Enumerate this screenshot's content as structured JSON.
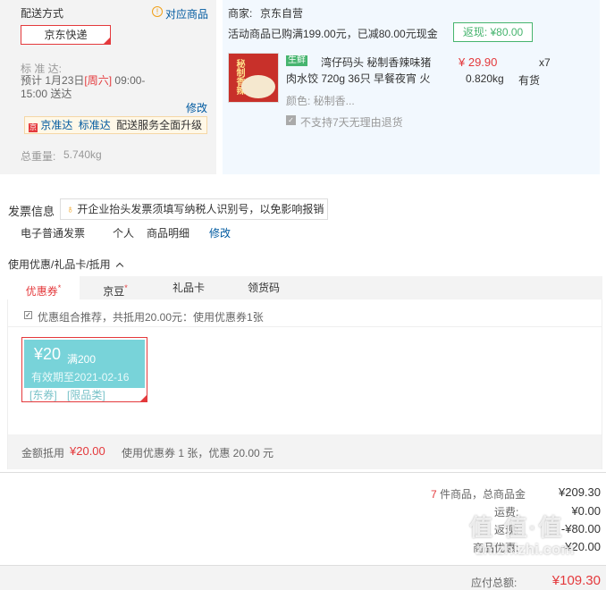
{
  "shipping": {
    "title": "配送方式",
    "match_products": "对应商品",
    "method": "京东快递",
    "std_label": "标 准 达:",
    "estimate_prefix": "预计",
    "date": "1月23日",
    "weekday": "[周六]",
    "time_line1": "09:00-",
    "time_line2": "15:00 送达",
    "modify": "修改",
    "jzd_icon": "京",
    "jzd_name": "京准达",
    "bzd_name": "标准达",
    "upgrade_text": "配送服务全面升级",
    "weight_label": "总重量:",
    "weight_value": "5.740kg"
  },
  "shop": {
    "seller_label": "商家:",
    "seller_name": "京东自营",
    "promo_text": "活动商品已购满199.00元，已减80.00元现金",
    "cashback": "返现: ¥80.00",
    "product": {
      "fresh_tag": "生鲜",
      "title_line1": "湾仔码头 秘制香辣味猪",
      "title_line2": "肉水饺 720g 36只 早餐夜宵 火",
      "price": "¥ 29.90",
      "qty": "x7",
      "weight": "0.820kg",
      "stock": "有货",
      "color": "颜色: 秘制香...",
      "no_return": "不支持7天无理由退货",
      "image_text": "秘制香辣"
    }
  },
  "invoice": {
    "title": "发票信息",
    "notice": "开企业抬头发票须填写纳税人识别号，以免影响报销",
    "type": "电子普通发票",
    "person": "个人",
    "detail": "商品明细",
    "modify": "修改"
  },
  "discount": {
    "title": "使用优惠/礼品卡/抵用",
    "tabs": [
      "优惠券",
      "京豆",
      "礼品卡",
      "领货码"
    ],
    "combo_text": "优惠组合推荐，共抵用20.00元：使用优惠券1张",
    "coupon": {
      "amount": "¥20",
      "condition": "满200",
      "expiry": "有效期至2021-02-16",
      "tag1": "[东券]",
      "tag2": "[限品类]"
    },
    "deduct_label": "金额抵用",
    "deduct_value": "¥20.00",
    "deduct_desc": "使用优惠券 1 张，优惠 20.00 元"
  },
  "summary": {
    "count": "7",
    "count_label": "件商品，总商品金",
    "total": "¥209.30",
    "freight_label": "运费:",
    "freight": "¥0.00",
    "row3_label": "返现:",
    "row3_value": "-¥80.00",
    "row4_label": "商品优惠:",
    "row4_value": "-¥20.00",
    "payable_label": "应付总额:",
    "payable": "¥109.30"
  },
  "watermark": "值 什么值得买 zhizhizhi.com",
  "colors": {
    "accent": "#e4393c",
    "link": "#005aa0",
    "coupon": "#78d3d9",
    "cashback": "#46b46e"
  }
}
